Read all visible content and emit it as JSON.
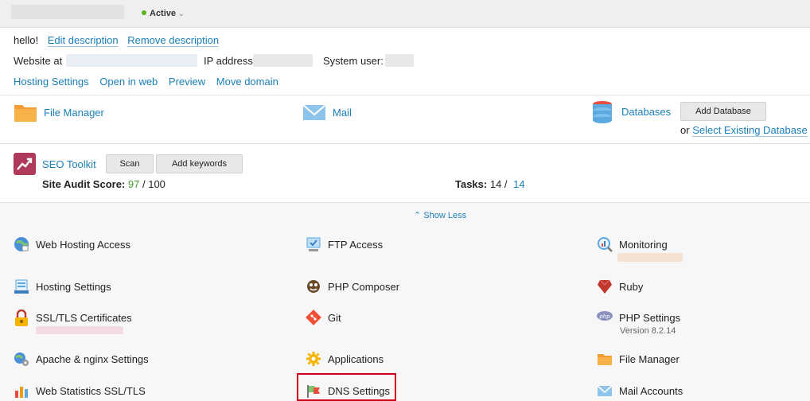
{
  "header": {
    "status_label": "Active",
    "status_caret": "⌄"
  },
  "description": {
    "text": "hello!",
    "edit_link": "Edit description",
    "remove_link": "Remove description"
  },
  "details": {
    "website_label": "Website at",
    "ip_label": "IP address",
    "system_user_label": "System user:"
  },
  "actions": {
    "hosting_settings": "Hosting Settings",
    "open_in_web": "Open in web",
    "preview": "Preview",
    "move_domain": "Move domain"
  },
  "quick_tiles": {
    "file_manager": "File Manager",
    "mail": "Mail",
    "databases": "Databases",
    "add_database": "Add Database",
    "or_text": "or",
    "select_existing_db": "Select Existing Database"
  },
  "seo": {
    "title": "SEO Toolkit",
    "scan": "Scan",
    "add_keywords": "Add keywords",
    "audit_label": "Site Audit Score:",
    "audit_score": "97",
    "audit_sep": "/ 100",
    "tasks_label": "Tasks:",
    "tasks_done": "14 /",
    "tasks_total": "14",
    "score_color": "#3f9b2c"
  },
  "show_less": "⌃ Show Less",
  "tools": {
    "col1": [
      {
        "label": "Web Hosting Access",
        "icon": "web-hosting-access-icon"
      },
      {
        "label": "Hosting Settings",
        "icon": "hosting-settings-icon"
      },
      {
        "label": "SSL/TLS Certificates",
        "icon": "ssl-lock-icon"
      },
      {
        "label": "Apache & nginx Settings",
        "icon": "apache-nginx-icon"
      },
      {
        "label": "Web Statistics SSL/TLS",
        "icon": "web-statistics-icon"
      }
    ],
    "col2": [
      {
        "label": "FTP Access",
        "icon": "ftp-access-icon"
      },
      {
        "label": "PHP Composer",
        "icon": "php-composer-icon"
      },
      {
        "label": "Git",
        "icon": "git-icon"
      },
      {
        "label": "Applications",
        "icon": "applications-icon"
      },
      {
        "label": "DNS Settings",
        "icon": "dns-settings-icon"
      }
    ],
    "col3": [
      {
        "label": "Monitoring",
        "icon": "monitoring-icon"
      },
      {
        "label": "Ruby",
        "icon": "ruby-icon"
      },
      {
        "label": "PHP Settings",
        "icon": "php-settings-icon",
        "sub": "Version 8.2.14"
      },
      {
        "label": "File Manager",
        "icon": "file-manager-icon"
      },
      {
        "label": "Mail Accounts",
        "icon": "mail-accounts-icon"
      }
    ]
  },
  "colors": {
    "link": "#1a7fb8",
    "highlight": "#d0021b",
    "active_dot": "#5bb11a"
  }
}
